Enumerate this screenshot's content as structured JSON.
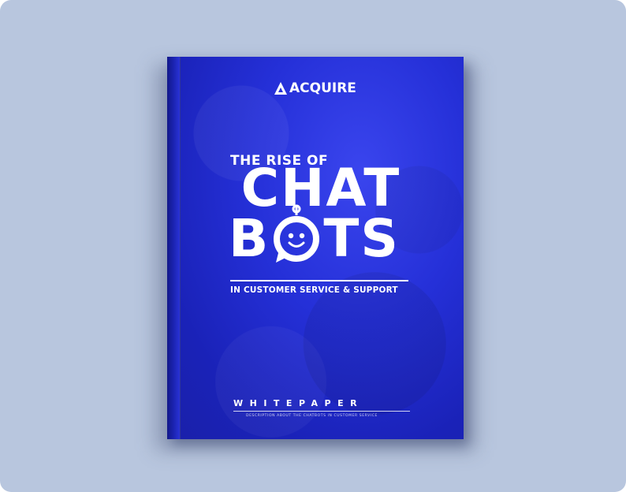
{
  "cover": {
    "brand": "ACQUIRE",
    "eyebrow": "THE RISE OF",
    "title_line1": "CHAT",
    "title_line2_left": "B",
    "title_line2_right": "TS",
    "subtitle": "IN CUSTOMER SERVICE & SUPPORT",
    "doc_type": "WHITEPAPER",
    "description": "DESCRIPTION ABOUT THE CHATBOTS IN CUSTOMER SERVICE"
  },
  "colors": {
    "background": "#b8c6de",
    "cover_blue": "#2530d8",
    "text": "#ffffff"
  },
  "icons": {
    "logo": "acquire-logo-icon",
    "bot": "chatbot-face-icon"
  }
}
